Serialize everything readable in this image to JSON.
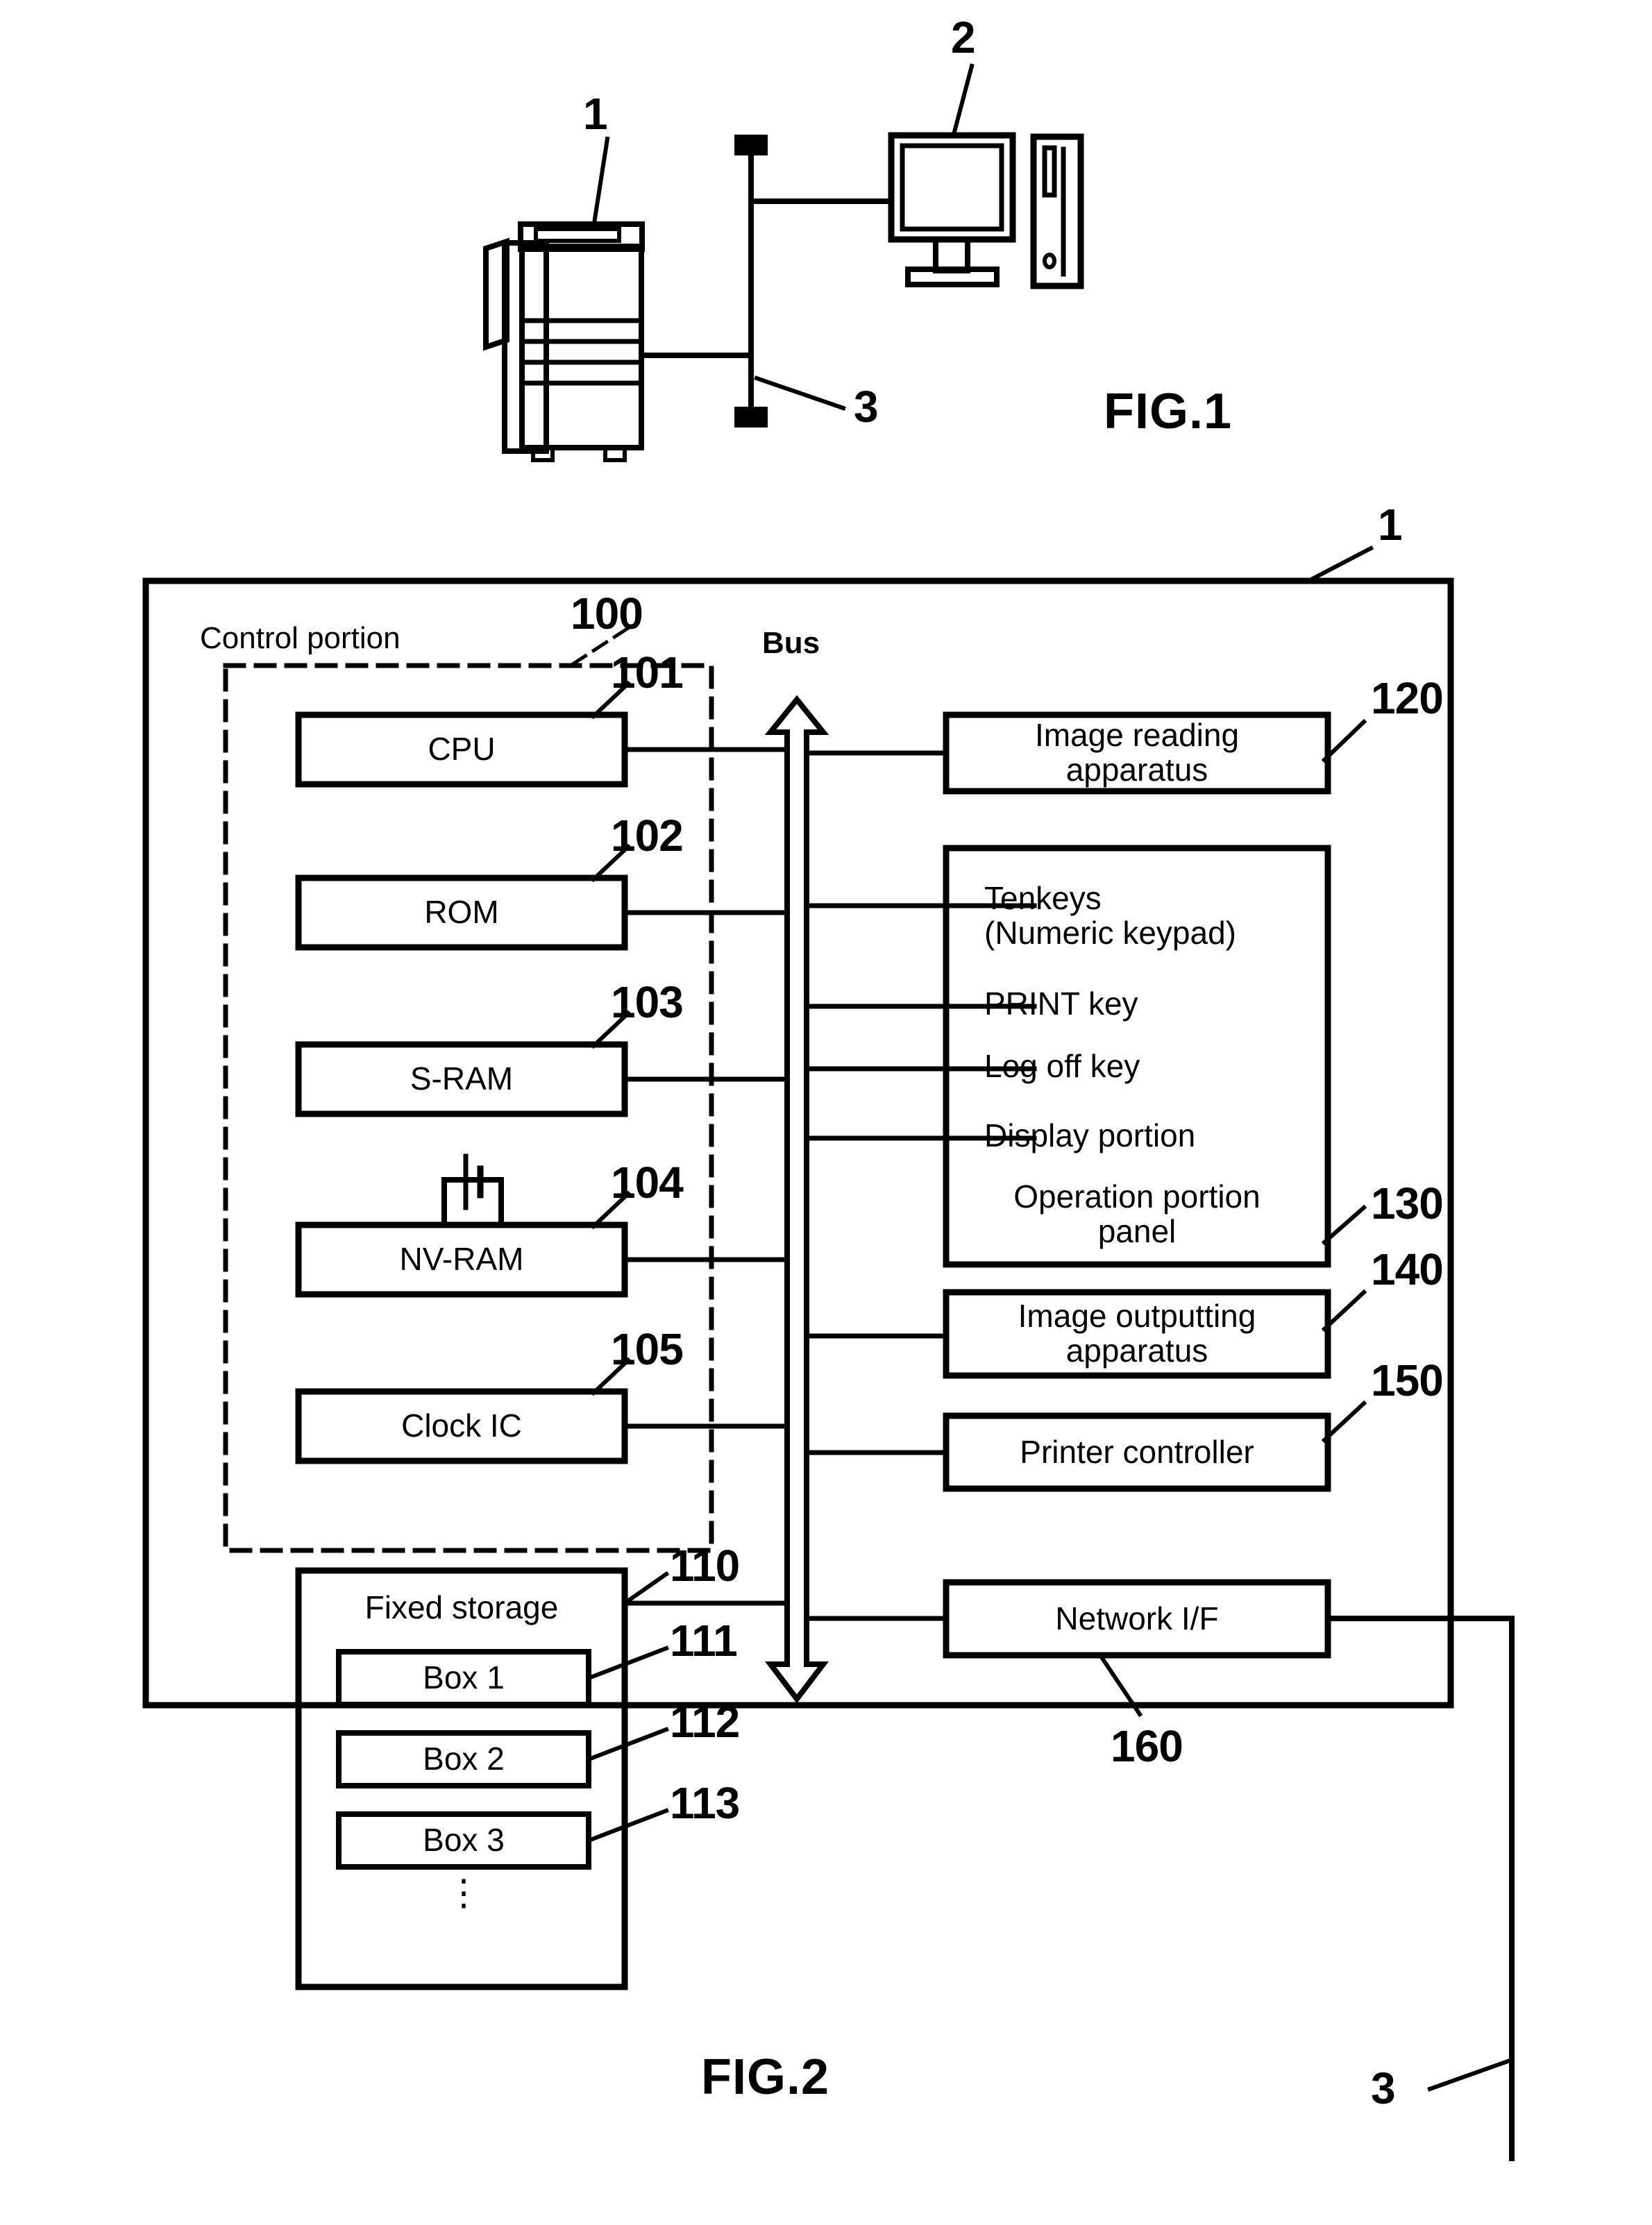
{
  "figures": [
    {
      "id": "fig1",
      "caption": "FIG.1",
      "callouts": [
        {
          "name": "mfp-callout",
          "text": "1"
        },
        {
          "name": "pc-callout",
          "text": "2"
        },
        {
          "name": "network-callout",
          "text": "3"
        }
      ],
      "nodes": [
        {
          "name": "mfp-icon",
          "label": "multifunction-printer"
        },
        {
          "name": "pc-monitor-icon",
          "label": "personal-computer-monitor"
        },
        {
          "name": "pc-tower-icon",
          "label": "personal-computer-tower"
        },
        {
          "name": "network-bus-line",
          "label": "network-cable"
        }
      ]
    },
    {
      "id": "fig2",
      "caption": "FIG.2",
      "outer_callout": "1",
      "network_callout": "3",
      "bus_label": "Bus",
      "control_portion": {
        "title": "Control portion",
        "callout": "100",
        "blocks": [
          {
            "label": "CPU",
            "callout": "101"
          },
          {
            "label": "ROM",
            "callout": "102"
          },
          {
            "label": "S-RAM",
            "callout": "103"
          },
          {
            "label": "NV-RAM",
            "callout": "104",
            "icon": "battery-icon"
          },
          {
            "label": "Clock IC",
            "callout": "105"
          }
        ]
      },
      "storage": {
        "label": "Fixed storage",
        "callout": "110",
        "boxes": [
          {
            "label": "Box 1",
            "callout": "111"
          },
          {
            "label": "Box 2",
            "callout": "112"
          },
          {
            "label": "Box 3",
            "callout": "113"
          }
        ],
        "ellipsis": "⋮"
      },
      "peripherals": [
        {
          "label": "Image reading\napparatus",
          "callout": "120"
        },
        {
          "label": "Image outputting\napparatus",
          "callout": "140"
        },
        {
          "label": "Printer controller",
          "callout": "150"
        },
        {
          "label": "Network I/F",
          "callout": "160"
        }
      ],
      "operation_panel": {
        "callout": "130",
        "items": [
          "Tenkeys\n(Numeric keypad)",
          "PRINT key",
          "Log off key",
          "Display portion",
          "Operation portion\npanel"
        ]
      }
    }
  ],
  "colors": {
    "ink": "#000000",
    "paper": "#ffffff"
  }
}
